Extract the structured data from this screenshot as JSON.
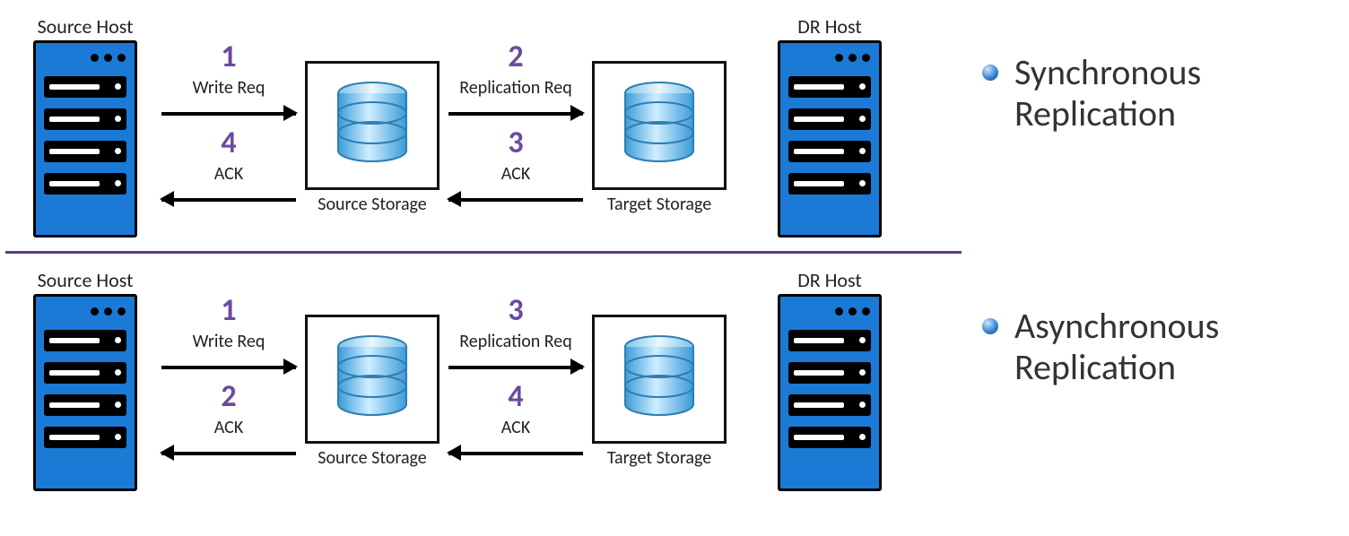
{
  "sync": {
    "caption_line1": "Synchronous",
    "caption_line2": "Replication",
    "source_host_label": "Source Host",
    "dr_host_label": "DR Host",
    "source_storage_label": "Source Storage",
    "target_storage_label": "Target Storage",
    "steps": {
      "s1": {
        "num": "1",
        "label": "Write Req"
      },
      "s2": {
        "num": "2",
        "label": "Replication Req"
      },
      "s3": {
        "num": "3",
        "label": "ACK"
      },
      "s4": {
        "num": "4",
        "label": "ACK"
      }
    }
  },
  "async": {
    "caption_line1": "Asynchronous",
    "caption_line2": "Replication",
    "source_host_label": "Source Host",
    "dr_host_label": "DR Host",
    "source_storage_label": "Source Storage",
    "target_storage_label": "Target Storage",
    "steps": {
      "s1": {
        "num": "1",
        "label": "Write Req"
      },
      "s2": {
        "num": "2",
        "label": "ACK"
      },
      "s3": {
        "num": "3",
        "label": "Replication Req"
      },
      "s4": {
        "num": "4",
        "label": "ACK"
      }
    }
  }
}
